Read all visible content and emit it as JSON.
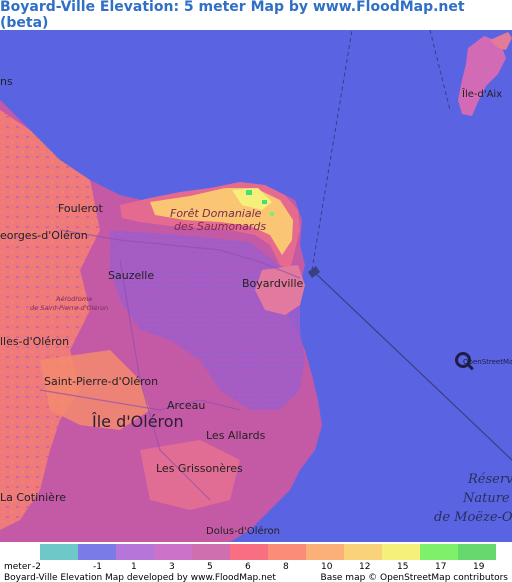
{
  "header": {
    "title": "Boyard-Ville Elevation: 5 meter Map by www.FloodMap.net (beta)"
  },
  "map": {
    "places": {
      "ile_daix": "Île-d'Aix",
      "fouras_partial": "ns",
      "foulerot": "Foulerot",
      "saint_georges": "eorges-d'Oléron",
      "foret_domaniale": "Forêt Domaniale",
      "des_saumonards": "des Saumonards",
      "sauzelle": "Sauzelle",
      "boyardville": "Boyardville",
      "aerodrome_1": "Aérodrome",
      "aerodrome_2": "de Saint-Pierre-d'Oléron",
      "cheray_partial": "lles-d'Oléron",
      "saint_pierre": "Saint-Pierre-d'Oléron",
      "arceau": "Arceau",
      "ile_doleron": "Île d'Oléron",
      "les_allards": "Les Allards",
      "les_grissoneres": "Les Grissonères",
      "cotiniere_partial": "La Cotinière",
      "dolus": "Dolus-d'Oléron",
      "reserve_1": "Réserv",
      "reserve_2": "Nature",
      "reserve_3": "de Moëze-O"
    },
    "osm_logo_text": "OpenStreetMap",
    "colors": {
      "sea": "#5a63e2",
      "low_land": "#c45aa5",
      "mid_land": "#e46a8f",
      "high_land": "#fb8a6b",
      "dune": "#fcd070",
      "peak": "#43e07a"
    }
  },
  "legend": {
    "unit_label": "meter",
    "swatches": [
      {
        "value": "-2",
        "color": "#6ec8c8"
      },
      {
        "value": "-1",
        "color": "#7b7be8"
      },
      {
        "value": "1",
        "color": "#b675d8"
      },
      {
        "value": "3",
        "color": "#cc72c8"
      },
      {
        "value": "5",
        "color": "#d06fb0"
      },
      {
        "value": "6",
        "color": "#f86f82"
      },
      {
        "value": "8",
        "color": "#fb8c78"
      },
      {
        "value": "10",
        "color": "#fbb078"
      },
      {
        "value": "12",
        "color": "#f9d27a"
      },
      {
        "value": "15",
        "color": "#f5f07a"
      },
      {
        "value": "17",
        "color": "#7ef06a"
      },
      {
        "value": "19",
        "color": "#67d86d"
      }
    ],
    "footer_left": "Boyard-Ville Elevation Map developed by www.FloodMap.net",
    "footer_right": "Base map © OpenStreetMap contributors"
  }
}
